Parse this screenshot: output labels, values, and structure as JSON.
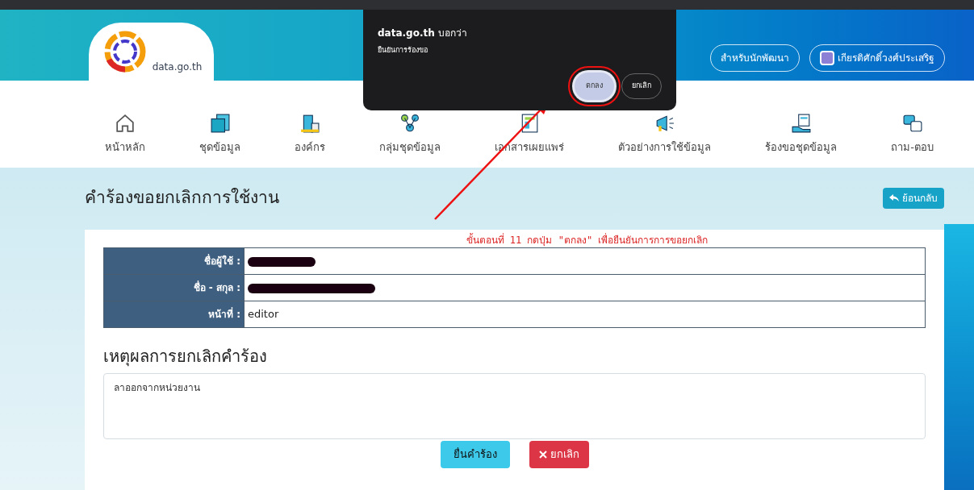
{
  "header": {
    "logo_text": "data.go.th",
    "buttons": [
      {
        "label": "สำหรับนักพัฒนา",
        "kind": "plain"
      },
      {
        "label": "เกียรติศักดิ์วงศ์ประเสริฐ",
        "kind": "user"
      }
    ]
  },
  "nav": [
    {
      "label": "หน้าหลัก",
      "kind": "home"
    },
    {
      "label": "ชุดข้อมูล",
      "kind": "folder"
    },
    {
      "label": "องค์กร",
      "kind": "building"
    },
    {
      "label": "กลุ่มชุดข้อมูล",
      "kind": "group"
    },
    {
      "label": "เอกสารเผยแพร่",
      "kind": "document"
    },
    {
      "label": "ตัวอย่างการใช้ข้อมูล",
      "kind": "megaphone"
    },
    {
      "label": "ร้องขอชุดข้อมูล",
      "kind": "request"
    },
    {
      "label": "ถาม-ตอบ",
      "kind": "qa"
    }
  ],
  "page": {
    "title": "คำร้องขอยกเลิกการใช้งาน",
    "back_button": "ย้อนกลับ"
  },
  "annotation": "ขั้นตอนที่ 11 กดปุ่ม \"ตกลง\" เพื่อยืนยันการการขอยกเลิก",
  "info_table": [
    {
      "label": "ชื่อผู้ใช้ :",
      "redacted": true
    },
    {
      "label": "ชื่อ - สกุล :",
      "redacted": true
    },
    {
      "label": "หน้าที่ :",
      "value": "editor",
      "redacted": false
    }
  ],
  "reason": {
    "heading": "เหตุผลการยกเลิกคำร้อง",
    "value": "ลาออกจากหน่วยงาน"
  },
  "form_buttons": [
    {
      "label": "ยื่นคำร้อง",
      "kind": "submit"
    },
    {
      "label": "ยกเลิก",
      "kind": "cancel"
    }
  ],
  "dialog": {
    "title": "**data.go.th** บอกว่า",
    "message": "ยืนยันการร้องขอ",
    "buttons": [
      {
        "label": "ตกลง",
        "selected": true
      },
      {
        "label": "ยกเลิก",
        "selected": false
      }
    ]
  }
}
